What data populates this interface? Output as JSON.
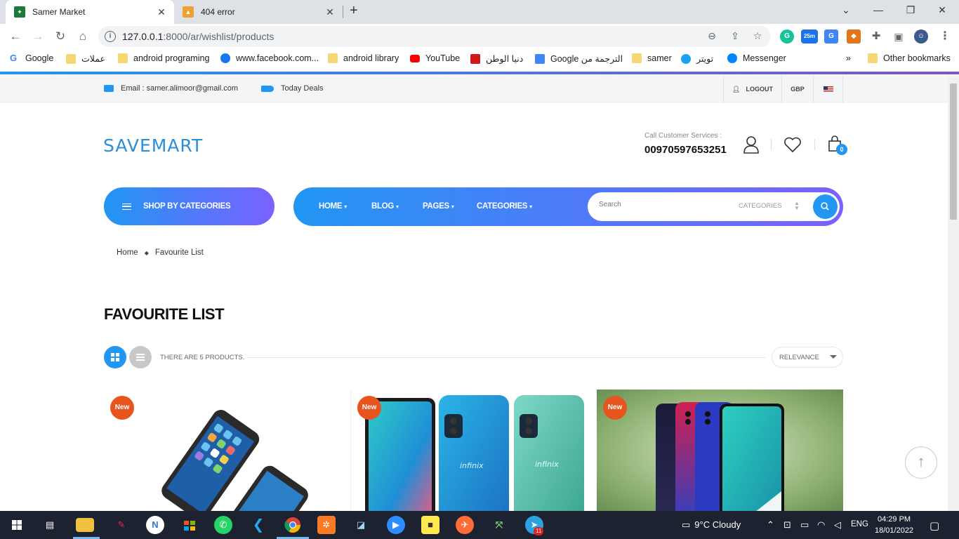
{
  "browser": {
    "tabs": [
      {
        "title": "Samer Market"
      },
      {
        "title": "404 error"
      }
    ],
    "url_host": "127.0.0.1",
    "url_rest": ":8000/ar/wishlist/products",
    "extension_badge": "25m",
    "bookmarks": [
      {
        "label": "Google"
      },
      {
        "label": "عملات"
      },
      {
        "label": "android programing"
      },
      {
        "label": "www.facebook.com..."
      },
      {
        "label": "android library"
      },
      {
        "label": "YouTube"
      },
      {
        "label": "دنيا الوطن"
      },
      {
        "label": "Google الترجمة من"
      },
      {
        "label": "samer"
      },
      {
        "label": "تويتر"
      },
      {
        "label": "Messenger"
      }
    ],
    "more_bookmarks": "»",
    "other_bookmarks": "Other bookmarks"
  },
  "topbar": {
    "email": "Email : samer.alimoor@gmail.com",
    "deals": "Today Deals",
    "logout": "LOGOUT",
    "currency": "GBP"
  },
  "header": {
    "logo": "SAVEMART",
    "call_label": "Call Customer Services :",
    "call_number": "00970597653251",
    "cart_count": "0"
  },
  "nav": {
    "shop_by_categories": "SHOP BY CATEGORIES",
    "items": [
      {
        "label": "HOME"
      },
      {
        "label": "BLOG"
      },
      {
        "label": "PAGES"
      },
      {
        "label": "CATEGORIES"
      }
    ],
    "search_placeholder": "Search",
    "search_categories": "CATEGORIES"
  },
  "breadcrumb": {
    "home": "Home",
    "current": "Favourite List"
  },
  "page": {
    "title": "FAVOURITE LIST",
    "count_text": "THERE ARE 5 PRODUCTS.",
    "sort": "RELEVANCE"
  },
  "products": [
    {
      "badge": "New"
    },
    {
      "badge": "New"
    },
    {
      "badge": "New"
    }
  ],
  "taskbar": {
    "weather": "9°C  Cloudy",
    "lang": "ENG",
    "time": "04:29 PM",
    "date": "18/01/2022",
    "telegram_badge": "11"
  },
  "colors": {
    "accent": "#2196f3",
    "gradient_end": "#7b61ff",
    "new_badge": "#e8541e",
    "logo": "#2b8fd8"
  }
}
